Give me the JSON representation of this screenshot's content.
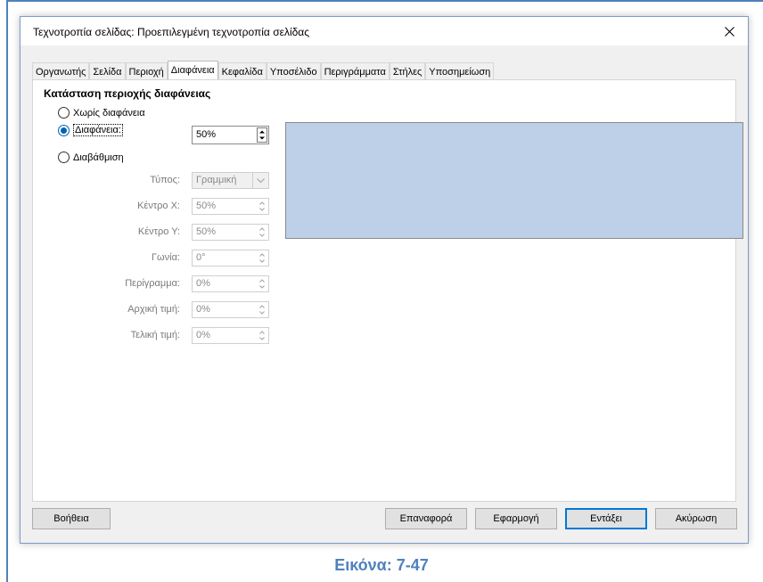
{
  "dialog": {
    "title": "Τεχνοτροπία σελίδας: Προεπιλεγμένη τεχνοτροπία σελίδας"
  },
  "tabs": [
    {
      "label": "Οργανωτής",
      "active": false
    },
    {
      "label": "Σελίδα",
      "active": false
    },
    {
      "label": "Περιοχή",
      "active": false
    },
    {
      "label": "Διαφάνεια",
      "active": true
    },
    {
      "label": "Κεφαλίδα",
      "active": false
    },
    {
      "label": "Υποσέλιδο",
      "active": false
    },
    {
      "label": "Περιγράμματα",
      "active": false
    },
    {
      "label": "Στήλες",
      "active": false
    },
    {
      "label": "Υποσημείωση",
      "active": false
    }
  ],
  "panel": {
    "section_title": "Κατάσταση περιοχής διαφάνειας",
    "modes": [
      {
        "label": "Χωρίς διαφάνεια",
        "checked": false
      },
      {
        "label": "Διαφάνεια:",
        "checked": true
      },
      {
        "label": "Διαβάθμιση",
        "checked": false
      }
    ],
    "transparency_value": "50%",
    "gradient": {
      "type_label": "Τύπος:",
      "type_value": "Γραμμική",
      "center_x_label": "Κέντρο Χ:",
      "center_x_value": "50%",
      "center_y_label": "Κέντρο Υ:",
      "center_y_value": "50%",
      "angle_label": "Γωνία:",
      "angle_value": "0°",
      "border_label": "Περίγραμμα:",
      "border_value": "0%",
      "start_label": "Αρχική τιμή:",
      "start_value": "0%",
      "end_label": "Τελική τιμή:",
      "end_value": "0%"
    },
    "preview_color": "#bdd0e7"
  },
  "buttons": {
    "help": "Βοήθεια",
    "reset": "Επαναφορά",
    "apply": "Εφαρμογή",
    "ok": "Εντάξει",
    "cancel": "Ακύρωση"
  },
  "caption": "Εικόνα: 7-47"
}
